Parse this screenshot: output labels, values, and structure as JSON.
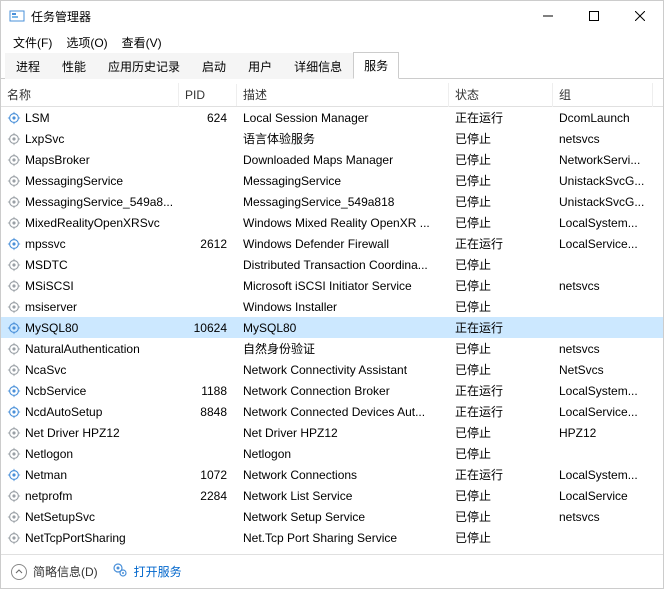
{
  "window": {
    "title": "任务管理器"
  },
  "menu": {
    "file": "文件(F)",
    "options": "选项(O)",
    "view": "查看(V)"
  },
  "tabs": {
    "items": [
      {
        "label": "进程"
      },
      {
        "label": "性能"
      },
      {
        "label": "应用历史记录"
      },
      {
        "label": "启动"
      },
      {
        "label": "用户"
      },
      {
        "label": "详细信息"
      },
      {
        "label": "服务"
      }
    ]
  },
  "columns": {
    "name": "名称",
    "pid": "PID",
    "desc": "描述",
    "status": "状态",
    "group": "组"
  },
  "services": [
    {
      "name": "LSM",
      "pid": "624",
      "desc": "Local Session Manager",
      "status": "正在运行",
      "group": "DcomLaunch"
    },
    {
      "name": "LxpSvc",
      "pid": "",
      "desc": "语言体验服务",
      "status": "已停止",
      "group": "netsvcs"
    },
    {
      "name": "MapsBroker",
      "pid": "",
      "desc": "Downloaded Maps Manager",
      "status": "已停止",
      "group": "NetworkServi..."
    },
    {
      "name": "MessagingService",
      "pid": "",
      "desc": "MessagingService",
      "status": "已停止",
      "group": "UnistackSvcG..."
    },
    {
      "name": "MessagingService_549a8...",
      "pid": "",
      "desc": "MessagingService_549a818",
      "status": "已停止",
      "group": "UnistackSvcG..."
    },
    {
      "name": "MixedRealityOpenXRSvc",
      "pid": "",
      "desc": "Windows Mixed Reality OpenXR ...",
      "status": "已停止",
      "group": "LocalSystem..."
    },
    {
      "name": "mpssvc",
      "pid": "2612",
      "desc": "Windows Defender Firewall",
      "status": "正在运行",
      "group": "LocalService..."
    },
    {
      "name": "MSDTC",
      "pid": "",
      "desc": "Distributed Transaction Coordina...",
      "status": "已停止",
      "group": ""
    },
    {
      "name": "MSiSCSI",
      "pid": "",
      "desc": "Microsoft iSCSI Initiator Service",
      "status": "已停止",
      "group": "netsvcs"
    },
    {
      "name": "msiserver",
      "pid": "",
      "desc": "Windows Installer",
      "status": "已停止",
      "group": ""
    },
    {
      "name": "MySQL80",
      "pid": "10624",
      "desc": "MySQL80",
      "status": "正在运行",
      "group": "",
      "selected": true
    },
    {
      "name": "NaturalAuthentication",
      "pid": "",
      "desc": "自然身份验证",
      "status": "已停止",
      "group": "netsvcs"
    },
    {
      "name": "NcaSvc",
      "pid": "",
      "desc": "Network Connectivity Assistant",
      "status": "已停止",
      "group": "NetSvcs"
    },
    {
      "name": "NcbService",
      "pid": "1188",
      "desc": "Network Connection Broker",
      "status": "正在运行",
      "group": "LocalSystem..."
    },
    {
      "name": "NcdAutoSetup",
      "pid": "8848",
      "desc": "Network Connected Devices Aut...",
      "status": "正在运行",
      "group": "LocalService..."
    },
    {
      "name": "Net Driver HPZ12",
      "pid": "",
      "desc": "Net Driver HPZ12",
      "status": "已停止",
      "group": "HPZ12"
    },
    {
      "name": "Netlogon",
      "pid": "",
      "desc": "Netlogon",
      "status": "已停止",
      "group": ""
    },
    {
      "name": "Netman",
      "pid": "1072",
      "desc": "Network Connections",
      "status": "正在运行",
      "group": "LocalSystem..."
    },
    {
      "name": "netprofm",
      "pid": "2284",
      "desc": "Network List Service",
      "status": "已停止",
      "group": "LocalService"
    },
    {
      "name": "NetSetupSvc",
      "pid": "",
      "desc": "Network Setup Service",
      "status": "已停止",
      "group": "netsvcs"
    },
    {
      "name": "NetTcpPortSharing",
      "pid": "",
      "desc": "Net.Tcp Port Sharing Service",
      "status": "已停止",
      "group": ""
    }
  ],
  "footer": {
    "brief": "简略信息(D)",
    "open": "打开服务"
  }
}
